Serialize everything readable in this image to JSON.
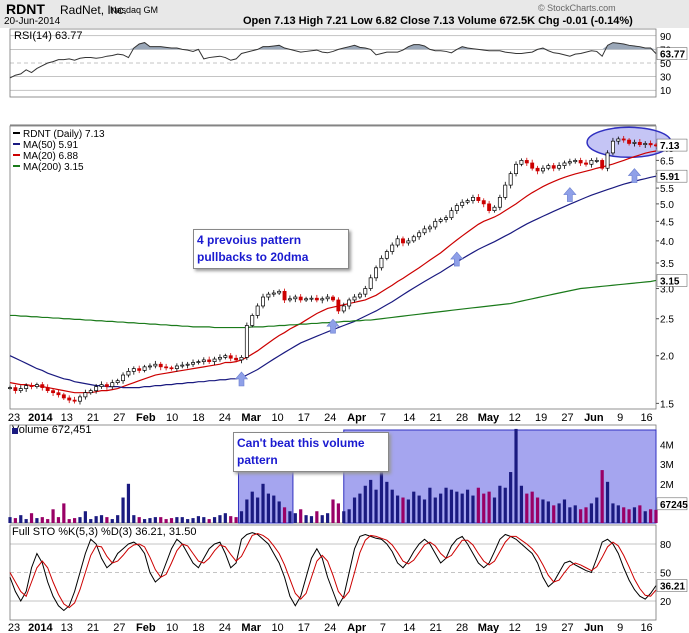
{
  "header": {
    "symbol": "RDNT",
    "company": "RadNet, Inc.",
    "exchange": "Nasdaq GM",
    "date": "20-Jun-2014",
    "copyright": "© StockCharts.com",
    "quote": "Open 7.13  High 7.21  Low 6.82  Close 7.13  Volume 672.5K  Chg -0.01 (-0.14%)"
  },
  "colors": {
    "up": "#000000",
    "down": "#cc0000",
    "ma20": "#cc0000",
    "ma50": "#1a1a80",
    "ma200": "#1a7a1a",
    "rsi_fill": "#9aa7b8",
    "vol_up": "#1a1a80",
    "vol_down": "#990066",
    "highlight": "#7f7fe8",
    "annotation": "#1a1ad0",
    "arrow": "#8fa0e8"
  },
  "chart_data": [
    {
      "type": "line",
      "panel": "rsi",
      "legend": "RSI(14) 63.77",
      "scale_labels": [
        "90",
        "70",
        "50",
        "30",
        "10"
      ],
      "ylim": [
        0,
        100
      ],
      "overbought": 70,
      "oversold": 30,
      "current": 63.77,
      "current_label": "63.77",
      "series": [
        {
          "name": "RSI(14)",
          "values": [
            28,
            32,
            34,
            40,
            36,
            42,
            46,
            50,
            52,
            55,
            55,
            56,
            54,
            57,
            58,
            58,
            57,
            58,
            60,
            61,
            63,
            62,
            58,
            72,
            78,
            80,
            74,
            74,
            74,
            73,
            72,
            72,
            70,
            69,
            67,
            70,
            56,
            58,
            59,
            60,
            58,
            54,
            56,
            64,
            66,
            68,
            70,
            74,
            74,
            75,
            76,
            72,
            70,
            68,
            66,
            67,
            68,
            69,
            66,
            65,
            67,
            70,
            72,
            74,
            76,
            73,
            72,
            70,
            62,
            64,
            66,
            66,
            66,
            69,
            74,
            77,
            77,
            75,
            70,
            68,
            68,
            67,
            65,
            70,
            74,
            72,
            71,
            70,
            69,
            68,
            68,
            68,
            66,
            65,
            64,
            64,
            65,
            66,
            70,
            72,
            68,
            65,
            64,
            62,
            60,
            63,
            64,
            66,
            68,
            67,
            60,
            76,
            80,
            79,
            78,
            76,
            75,
            74,
            72,
            72,
            63.77
          ]
        }
      ]
    },
    {
      "type": "candlestick",
      "panel": "price",
      "scale": "log",
      "ylim": [
        1.45,
        8.0
      ],
      "legend": [
        "RDNT (Daily) 7.13",
        "MA(50) 5.91",
        "MA(20) 6.88",
        "MA(200) 3.15"
      ],
      "y_ticks": [
        "7.0",
        "6.5",
        "6.0",
        "5.5",
        "5.0",
        "4.5",
        "4.0",
        "3.5",
        "3.0",
        "2.5",
        "2.0",
        "1.5"
      ],
      "right_labels": {
        "close": "7.13",
        "ma50": "5.91",
        "ma200": "3.15"
      },
      "close": [
        1.65,
        1.62,
        1.64,
        1.67,
        1.66,
        1.68,
        1.65,
        1.62,
        1.6,
        1.58,
        1.55,
        1.53,
        1.52,
        1.56,
        1.6,
        1.62,
        1.66,
        1.68,
        1.66,
        1.7,
        1.72,
        1.78,
        1.82,
        1.85,
        1.83,
        1.87,
        1.88,
        1.9,
        1.87,
        1.86,
        1.85,
        1.88,
        1.89,
        1.9,
        1.92,
        1.93,
        1.95,
        1.93,
        1.96,
        1.98,
        2.0,
        1.97,
        1.95,
        1.98,
        2.4,
        2.55,
        2.7,
        2.85,
        2.9,
        2.92,
        2.95,
        2.8,
        2.82,
        2.85,
        2.8,
        2.82,
        2.83,
        2.8,
        2.82,
        2.85,
        2.8,
        2.62,
        2.7,
        2.8,
        2.85,
        2.9,
        3.0,
        3.2,
        3.4,
        3.6,
        3.75,
        3.9,
        4.05,
        3.95,
        4.0,
        4.1,
        4.2,
        4.3,
        4.35,
        4.5,
        4.55,
        4.6,
        4.8,
        4.95,
        5.05,
        5.1,
        5.2,
        5.1,
        5.0,
        4.8,
        4.9,
        5.2,
        5.6,
        6.0,
        6.35,
        6.5,
        6.4,
        6.2,
        6.1,
        6.2,
        6.3,
        6.2,
        6.3,
        6.4,
        6.45,
        6.5,
        6.4,
        6.35,
        6.5,
        6.5,
        6.2,
        6.8,
        7.3,
        7.4,
        7.35,
        7.2,
        7.25,
        7.15,
        7.2,
        7.14,
        7.13
      ],
      "series": [
        {
          "name": "MA(20)",
          "values": [
            1.7,
            1.69,
            1.68,
            1.68,
            1.67,
            1.67,
            1.66,
            1.65,
            1.64,
            1.63,
            1.62,
            1.61,
            1.6,
            1.6,
            1.6,
            1.6,
            1.61,
            1.62,
            1.62,
            1.63,
            1.64,
            1.66,
            1.68,
            1.7,
            1.72,
            1.74,
            1.76,
            1.78,
            1.79,
            1.8,
            1.81,
            1.82,
            1.83,
            1.84,
            1.85,
            1.86,
            1.87,
            1.88,
            1.89,
            1.9,
            1.92,
            1.92,
            1.93,
            1.95,
            1.98,
            2.02,
            2.06,
            2.11,
            2.16,
            2.21,
            2.26,
            2.3,
            2.35,
            2.39,
            2.43,
            2.48,
            2.53,
            2.58,
            2.62,
            2.66,
            2.68,
            2.7,
            2.72,
            2.74,
            2.76,
            2.78,
            2.8,
            2.84,
            2.88,
            2.94,
            3.0,
            3.06,
            3.13,
            3.19,
            3.26,
            3.33,
            3.4,
            3.48,
            3.56,
            3.64,
            3.72,
            3.82,
            3.92,
            4.02,
            4.12,
            4.22,
            4.32,
            4.42,
            4.5,
            4.56,
            4.62,
            4.7,
            4.8,
            4.9,
            5.0,
            5.12,
            5.24,
            5.35,
            5.45,
            5.55,
            5.64,
            5.72,
            5.8,
            5.87,
            5.93,
            5.99,
            6.04,
            6.09,
            6.14,
            6.2,
            6.25,
            6.3,
            6.36,
            6.43,
            6.5,
            6.58,
            6.65,
            6.72,
            6.79,
            6.84,
            6.88
          ]
        },
        {
          "name": "MA(50)",
          "values": [
            2.0,
            1.97,
            1.94,
            1.91,
            1.88,
            1.85,
            1.83,
            1.8,
            1.78,
            1.76,
            1.74,
            1.73,
            1.71,
            1.7,
            1.69,
            1.68,
            1.67,
            1.67,
            1.66,
            1.66,
            1.66,
            1.65,
            1.65,
            1.65,
            1.65,
            1.66,
            1.66,
            1.67,
            1.67,
            1.68,
            1.68,
            1.69,
            1.69,
            1.7,
            1.7,
            1.71,
            1.71,
            1.72,
            1.72,
            1.73,
            1.73,
            1.74,
            1.74,
            1.75,
            1.78,
            1.81,
            1.84,
            1.88,
            1.92,
            1.96,
            2.0,
            2.04,
            2.08,
            2.12,
            2.16,
            2.19,
            2.22,
            2.25,
            2.28,
            2.31,
            2.34,
            2.37,
            2.4,
            2.43,
            2.46,
            2.5,
            2.54,
            2.58,
            2.62,
            2.67,
            2.72,
            2.77,
            2.83,
            2.89,
            2.95,
            3.01,
            3.07,
            3.13,
            3.19,
            3.25,
            3.31,
            3.38,
            3.45,
            3.52,
            3.59,
            3.66,
            3.73,
            3.8,
            3.86,
            3.92,
            3.98,
            4.05,
            4.12,
            4.19,
            4.27,
            4.35,
            4.43,
            4.5,
            4.57,
            4.64,
            4.71,
            4.78,
            4.85,
            4.92,
            4.99,
            5.06,
            5.13,
            5.2,
            5.27,
            5.33,
            5.39,
            5.45,
            5.51,
            5.57,
            5.63,
            5.68,
            5.73,
            5.78,
            5.82,
            5.87,
            5.91
          ]
        },
        {
          "name": "MA(200)",
          "values": [
            2.55,
            2.55,
            2.54,
            2.54,
            2.53,
            2.53,
            2.52,
            2.52,
            2.51,
            2.51,
            2.5,
            2.5,
            2.49,
            2.49,
            2.48,
            2.48,
            2.47,
            2.47,
            2.46,
            2.46,
            2.45,
            2.45,
            2.44,
            2.44,
            2.43,
            2.43,
            2.42,
            2.42,
            2.41,
            2.41,
            2.4,
            2.4,
            2.39,
            2.39,
            2.38,
            2.38,
            2.38,
            2.38,
            2.37,
            2.37,
            2.37,
            2.37,
            2.37,
            2.37,
            2.37,
            2.38,
            2.38,
            2.38,
            2.39,
            2.39,
            2.4,
            2.4,
            2.41,
            2.41,
            2.42,
            2.42,
            2.43,
            2.43,
            2.44,
            2.44,
            2.45,
            2.45,
            2.46,
            2.46,
            2.47,
            2.47,
            2.48,
            2.48,
            2.49,
            2.5,
            2.51,
            2.52,
            2.53,
            2.54,
            2.55,
            2.56,
            2.57,
            2.58,
            2.59,
            2.6,
            2.61,
            2.62,
            2.63,
            2.64,
            2.65,
            2.66,
            2.67,
            2.68,
            2.69,
            2.7,
            2.71,
            2.72,
            2.73,
            2.74,
            2.76,
            2.78,
            2.8,
            2.82,
            2.84,
            2.86,
            2.88,
            2.9,
            2.92,
            2.94,
            2.96,
            2.98,
            3.0,
            3.01,
            3.02,
            3.03,
            3.04,
            3.05,
            3.06,
            3.07,
            3.08,
            3.09,
            3.1,
            3.11,
            3.12,
            3.13,
            3.15
          ]
        }
      ]
    },
    {
      "type": "bar",
      "panel": "volume",
      "legend": "Volume 672,451",
      "ylim": [
        0,
        5000000
      ],
      "y_ticks": [
        "4M",
        "3M",
        "2M",
        "1M"
      ],
      "current_label": "67245",
      "values": [
        300000,
        250000,
        400000,
        200000,
        500000,
        250000,
        300000,
        200000,
        700000,
        300000,
        1000000,
        200000,
        250000,
        300000,
        600000,
        200000,
        350000,
        400000,
        300000,
        200000,
        400000,
        1300000,
        2000000,
        400000,
        300000,
        200000,
        250000,
        300000,
        300000,
        200000,
        250000,
        300000,
        300000,
        200000,
        250000,
        350000,
        300000,
        200000,
        300000,
        400000,
        500000,
        350000,
        300000,
        600000,
        1200000,
        1600000,
        1300000,
        2000000,
        1500000,
        1400000,
        1100000,
        800000,
        600000,
        500000,
        700000,
        400000,
        350000,
        600000,
        400000,
        500000,
        1200000,
        1000000,
        600000,
        700000,
        1300000,
        1500000,
        1900000,
        2200000,
        1700000,
        2800000,
        2100000,
        1700000,
        1400000,
        1300000,
        1200000,
        1600000,
        1400000,
        1200000,
        1800000,
        1300000,
        1500000,
        1800000,
        1700000,
        1600000,
        1500000,
        1700000,
        1400000,
        1800000,
        1500000,
        1600000,
        1300000,
        1900000,
        1800000,
        2600000,
        4800000,
        1900000,
        1500000,
        1600000,
        1300000,
        1200000,
        1100000,
        900000,
        1000000,
        1200000,
        800000,
        900000,
        700000,
        800000,
        1000000,
        1300000,
        2700000,
        2100000,
        1000000,
        900000,
        800000,
        700000,
        800000,
        900000,
        600000,
        700000,
        672451
      ]
    },
    {
      "type": "line",
      "panel": "stochastic",
      "legend": "Full STO %K(5,3) %D(3) 36.21, 31.50",
      "ylim": [
        0,
        100
      ],
      "y_ticks": [
        "80",
        "50",
        "20"
      ],
      "current_label": "36.21",
      "series": [
        {
          "name": "%K(5,3)",
          "values": [
            45,
            30,
            20,
            30,
            55,
            70,
            60,
            40,
            25,
            15,
            10,
            15,
            30,
            50,
            70,
            85,
            80,
            65,
            55,
            60,
            70,
            75,
            80,
            82,
            78,
            70,
            50,
            40,
            45,
            60,
            75,
            85,
            80,
            70,
            60,
            55,
            65,
            75,
            80,
            82,
            70,
            55,
            60,
            85,
            90,
            92,
            90,
            85,
            80,
            70,
            60,
            45,
            25,
            15,
            25,
            45,
            65,
            75,
            65,
            45,
            30,
            15,
            25,
            50,
            75,
            88,
            90,
            88,
            86,
            85,
            80,
            72,
            60,
            55,
            62,
            72,
            80,
            85,
            80,
            70,
            60,
            65,
            78,
            85,
            88,
            80,
            70,
            60,
            55,
            60,
            72,
            85,
            90,
            88,
            85,
            80,
            75,
            70,
            60,
            45,
            35,
            40,
            50,
            60,
            62,
            58,
            55,
            52,
            50,
            65,
            82,
            85,
            80,
            70,
            55,
            42,
            32,
            25,
            22,
            28,
            36.21
          ]
        },
        {
          "name": "%D(3)",
          "values": [
            50,
            40,
            30,
            25,
            40,
            55,
            62,
            55,
            40,
            27,
            17,
            13,
            18,
            32,
            50,
            68,
            78,
            77,
            67,
            60,
            62,
            68,
            75,
            79,
            80,
            77,
            66,
            53,
            45,
            48,
            60,
            73,
            80,
            78,
            70,
            62,
            60,
            65,
            73,
            79,
            77,
            69,
            62,
            67,
            78,
            89,
            91,
            89,
            85,
            78,
            70,
            58,
            43,
            28,
            22,
            28,
            45,
            62,
            68,
            62,
            47,
            30,
            23,
            30,
            50,
            71,
            84,
            89,
            88,
            86,
            84,
            79,
            71,
            62,
            59,
            63,
            71,
            79,
            82,
            78,
            70,
            65,
            68,
            76,
            84,
            84,
            79,
            70,
            62,
            58,
            62,
            72,
            82,
            88,
            88,
            84,
            80,
            75,
            68,
            58,
            47,
            40,
            42,
            50,
            57,
            60,
            58,
            55,
            52,
            56,
            66,
            77,
            82,
            78,
            68,
            56,
            43,
            33,
            26,
            25,
            31.5
          ]
        }
      ]
    }
  ],
  "x_axis": {
    "labels": [
      "23",
      "2014",
      "13",
      "21",
      "27",
      "Feb",
      "10",
      "18",
      "24",
      "Mar",
      "10",
      "17",
      "24",
      "Apr",
      "7",
      "14",
      "21",
      "28",
      "May",
      "12",
      "19",
      "27",
      "Jun",
      "9",
      "16"
    ]
  },
  "annotations": {
    "pullback_note": "4 prevoius pattern pullbacks to 20dma",
    "volume_note": "Can't beat this volume pattern"
  }
}
